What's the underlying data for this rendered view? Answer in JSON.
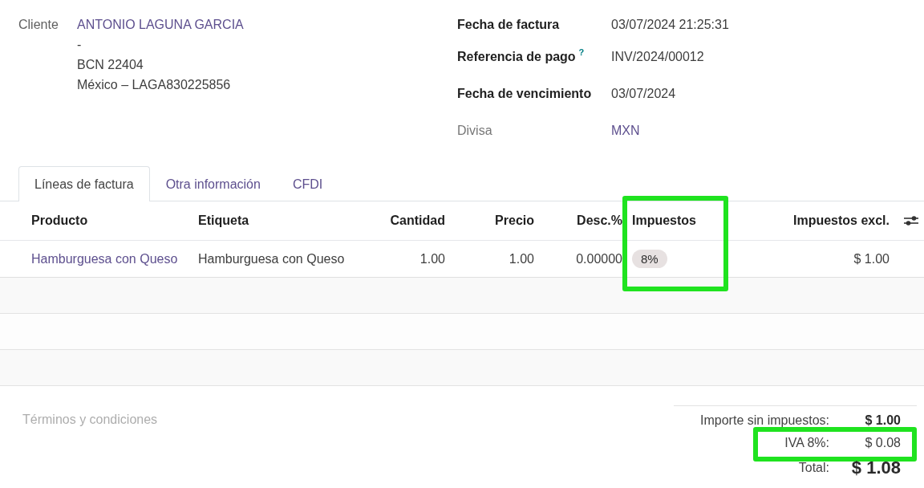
{
  "customer": {
    "label": "Cliente",
    "name": "ANTONIO LAGUNA GARCIA",
    "address_lines": [
      "-",
      "BCN 22404",
      "México – LAGA830225856"
    ]
  },
  "invoice_fields": [
    {
      "label": "Fecha de factura",
      "value": "03/07/2024 21:25:31",
      "readonly": false,
      "kind": "text"
    },
    {
      "label": "Referencia de pago",
      "help": "?",
      "value": "INV/2024/00012",
      "readonly": false,
      "kind": "text"
    },
    {
      "label": "Fecha de vencimiento",
      "value": "03/07/2024",
      "readonly": false,
      "kind": "text"
    },
    {
      "label": "Divisa",
      "value": "MXN",
      "readonly": true,
      "kind": "link"
    }
  ],
  "tabs": [
    {
      "label": "Líneas de factura",
      "selected": true
    },
    {
      "label": "Otra información",
      "selected": false
    },
    {
      "label": "CFDI",
      "selected": false
    }
  ],
  "table": {
    "columns": [
      {
        "label": "Producto",
        "kind": "link",
        "highlighted": false
      },
      {
        "label": "Etiqueta",
        "kind": "text",
        "highlighted": false
      },
      {
        "label": "Cantidad",
        "kind": "number",
        "highlighted": false
      },
      {
        "label": "Precio",
        "kind": "number",
        "highlighted": false
      },
      {
        "label": "Desc.%",
        "kind": "number",
        "highlighted": false
      },
      {
        "label": "Impuestos",
        "kind": "tags",
        "highlighted": true
      },
      {
        "label": "Impuestos excl.",
        "kind": "number",
        "highlighted": false
      }
    ],
    "rows": [
      {
        "cells": [
          "Hamburguesa con Queso",
          "Hamburguesa con Queso",
          "1.00",
          "1.00",
          "0.00000",
          [
            "8%"
          ],
          "$ 1.00"
        ]
      }
    ]
  },
  "terms": {
    "placeholder": "Términos y condiciones"
  },
  "totals": [
    {
      "label": "Importe sin impuestos:",
      "value": "$ 1.00",
      "kind": "subtotal",
      "highlighted": false
    },
    {
      "label": "IVA 8%:",
      "value": "$ 0.08",
      "kind": "tax",
      "highlighted": true
    },
    {
      "label": "Total:",
      "value": "$ 1.08",
      "kind": "total",
      "highlighted": false
    }
  ]
}
